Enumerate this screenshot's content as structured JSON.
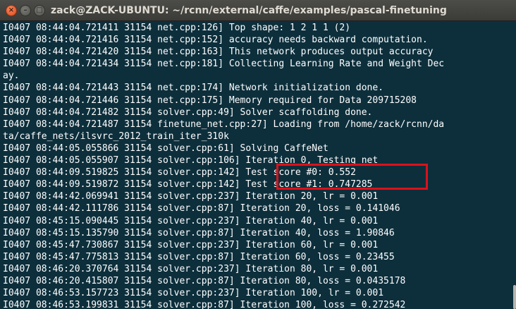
{
  "window": {
    "title": "zack@ZACK-UBUNTU: ~/rcnn/external/caffe/examples/pascal-finetuning",
    "buttons": {
      "close": "×",
      "minimize": "–",
      "maximize": "□"
    }
  },
  "terminal": {
    "lines": [
      "I0407 08:44:04.721411 31154 net.cpp:126] Top shape: 1 2 1 1 (2)",
      "I0407 08:44:04.721416 31154 net.cpp:152] accuracy needs backward computation.",
      "I0407 08:44:04.721420 31154 net.cpp:163] This network produces output accuracy",
      "I0407 08:44:04.721434 31154 net.cpp:181] Collecting Learning Rate and Weight Dec",
      "ay.",
      "I0407 08:44:04.721443 31154 net.cpp:174] Network initialization done.",
      "I0407 08:44:04.721446 31154 net.cpp:175] Memory required for Data 209715208",
      "I0407 08:44:04.721482 31154 solver.cpp:49] Solver scaffolding done.",
      "I0407 08:44:04.721487 31154 finetune_net.cpp:27] Loading from /home/zack/rcnn/da",
      "ta/caffe_nets/ilsvrc_2012_train_iter_310k",
      "I0407 08:44:05.055866 31154 solver.cpp:61] Solving CaffeNet",
      "I0407 08:44:05.055907 31154 solver.cpp:106] Iteration 0, Testing net",
      "I0407 08:44:09.519825 31154 solver.cpp:142] Test score #0: 0.552",
      "I0407 08:44:09.519872 31154 solver.cpp:142] Test score #1: 0.747285",
      "I0407 08:44:42.069941 31154 solver.cpp:237] Iteration 20, lr = 0.001",
      "I0407 08:44:42.111786 31154 solver.cpp:87] Iteration 20, loss = 0.141046",
      "I0407 08:45:15.090445 31154 solver.cpp:237] Iteration 40, lr = 0.001",
      "I0407 08:45:15.135790 31154 solver.cpp:87] Iteration 40, loss = 1.90846",
      "I0407 08:45:47.730867 31154 solver.cpp:237] Iteration 60, lr = 0.001",
      "I0407 08:45:47.775813 31154 solver.cpp:87] Iteration 60, loss = 0.23455",
      "I0407 08:46:20.370764 31154 solver.cpp:237] Iteration 80, lr = 0.001",
      "I0407 08:46:20.415807 31154 solver.cpp:87] Iteration 80, loss = 0.0435178",
      "I0407 08:46:53.157723 31154 solver.cpp:237] Iteration 100, lr = 0.001",
      "I0407 08:46:53.199831 31154 solver.cpp:87] Iteration 100, loss = 0.272542"
    ]
  },
  "colors": {
    "terminal_background": "#0d2f3c",
    "terminal_text": "#ffffff",
    "highlight_border": "#d9121b",
    "titlebar": "#3c3b37",
    "close_button": "#e05a2b"
  }
}
